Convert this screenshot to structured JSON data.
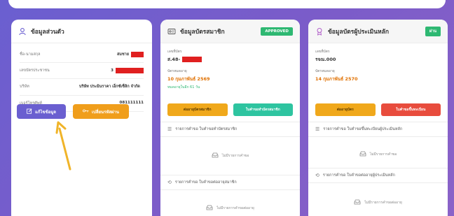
{
  "personal": {
    "title": "ข้อมูลส่วนตัว",
    "rows": [
      {
        "label": "ชื่อ-นามสกุล",
        "value": "สมชาย"
      },
      {
        "label": "เลขบัตรประชาชน",
        "value": "3"
      },
      {
        "label": "บริษัท",
        "value": "บริษัท ประมินราคา เอ็กซ์เซ็ลิก จำกัด"
      },
      {
        "label": "เบอร์โทรศัพท์",
        "value": "081111111"
      }
    ],
    "edit_label": "แก้ไขข้อมูล",
    "change_password_label": "เปลี่ยนรหัสผ่าน"
  },
  "member_card": {
    "title": "ข้อมูลบัตรสมาชิก",
    "status": "APPROVED",
    "number_label": "เลขที่บัตร",
    "number_value": "ส.48-",
    "expiry_label": "บัตรหมดอายุ",
    "expiry_value": "10 กุมภาพันธ์ 2569",
    "remaining": "หมดอายุในอีก 61 วัน",
    "btn_renew": "ต่ออายุบัตรสมาชิก",
    "btn_history": "ใบคำขอทำบัตรสมาชิก",
    "section1": "รายการคำขอ ใบคำขอทำบัตรสมาชิก",
    "empty1": "ไม่มีรายการคำขอ",
    "section2": "รายการคำขอ ใบคำขอต่ออายุสมาชิก",
    "empty2": "ไม่มีรายการคำขอต่ออายุ"
  },
  "appraiser_card": {
    "title": "ข้อมูลบัตรผู้ประเมินหลัก",
    "status": "ผ่าน",
    "number_label": "เลขที่บัตร",
    "number_value": "รจณ.000",
    "expiry_label": "บัตรหมดอายุ",
    "expiry_value": "14 กุมภาพันธ์ 2570",
    "btn_renew": "ต่ออายุบัตร",
    "btn_register": "ใบคำขอขึ้นทะเบียน",
    "section1": "รายการคำขอ ใบคำขอขึ้นทะเบียนผู้ประเมินหลัก",
    "empty1": "ไม่มีรายการคำขอ",
    "section2": "รายการคำขอ ใบคำขอต่ออายุผู้ประเมินหลัก",
    "empty2": "ไม่มีรายการคำขอต่ออายุ"
  },
  "colors": {
    "background": "#7b5cc9",
    "approved": "#2eb872",
    "redacted": "#e02020",
    "edit": "#6a5fd0",
    "password": "#f09e1b",
    "arrow": "#f0b429"
  }
}
